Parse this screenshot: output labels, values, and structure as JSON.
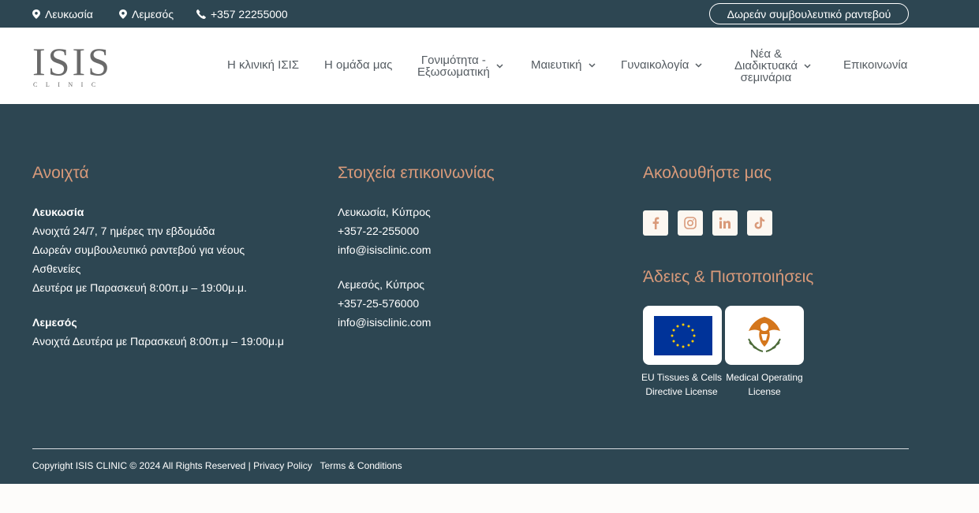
{
  "topbar": {
    "location1": "Λευκωσία",
    "location2": "Λεμεσός",
    "phone": "+357 22255000",
    "cta": "Δωρεάν συμβουλευτικό ραντεβού"
  },
  "logo": {
    "main": "ISIS",
    "sub": "CLINIC"
  },
  "nav": {
    "items": [
      {
        "label": "Η κλινική ΙΣΙΣ"
      },
      {
        "label": "Η ομάδα μας"
      },
      {
        "label_line1": "Γονιμότητα -",
        "label_line2": "Εξωσωματική"
      },
      {
        "label": "Μαιευτική"
      },
      {
        "label": "Γυναικολογία"
      },
      {
        "label_line1": "Νέα &",
        "label_line2": "Διαδικτυακά",
        "label_line3": "σεμινάρια"
      },
      {
        "label": "Επικοινωνία"
      }
    ]
  },
  "footer": {
    "open": {
      "title": "Ανοιχτά",
      "nicosia_heading": "Λευκωσία",
      "nicosia_line1": "Ανοιχτά 24/7, 7 ημέρες την εβδομάδα",
      "nicosia_line2": "Δωρεάν συμβουλευτικό ραντεβού για νέους",
      "nicosia_line3": "Ασθενείες",
      "nicosia_line4": "Δευτέρα με Παρασκευή 8:00π.μ – 19:00μ.μ.",
      "limassol_heading": "Λεμεσός",
      "limassol_line1": "Ανοιχτά Δευτέρα με Παρασκευή 8:00π.μ – 19:00μ.μ"
    },
    "contact": {
      "title": "Στοιχεία επικοινωνίας",
      "nicosia": "Λευκωσία, Κύπρος",
      "nicosia_phone": "+357-22-255000",
      "nicosia_email": "info@isisclinic.com",
      "limassol": "Λεμεσός, Κύπρος",
      "limassol_phone": "+357-25-576000",
      "limassol_email": "info@isisclinic.com"
    },
    "follow": {
      "title": "Ακολουθήστε μας",
      "icons": [
        "facebook-icon",
        "instagram-icon",
        "linkedin-icon",
        "tiktok-icon"
      ]
    },
    "licenses": {
      "title": "Άδειες & Πιστοποιήσεις",
      "eu_line1": "EU Tissues & Cells",
      "eu_line2": "Directive License",
      "med_line1": "Medical Operating",
      "med_line2": "License"
    },
    "copyright": "Copyright ISIS CLINIC © 2024 All Rights Reserved |",
    "privacy": "Privacy Policy",
    "terms": "Terms & Conditions"
  },
  "colors": {
    "dark": "#2d4652",
    "accent": "#d99a7a",
    "eu_blue": "#003399",
    "eu_star": "#ffcc00"
  }
}
